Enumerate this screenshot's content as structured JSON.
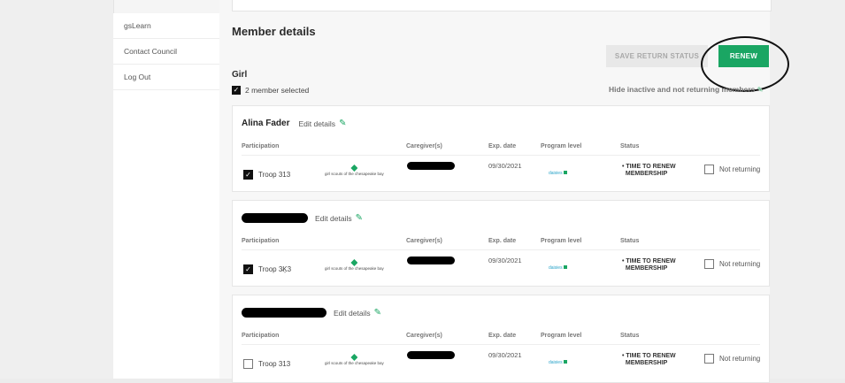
{
  "sidebar": {
    "items": [
      {
        "label": "gsLearn"
      },
      {
        "label": "Contact Council"
      },
      {
        "label": "Log Out"
      }
    ]
  },
  "main": {
    "title": "Member details",
    "buttons": {
      "save_status": "SAVE RETURN STATUS",
      "renew": "RENEW"
    },
    "group_label": "Girl",
    "selection_text": "2 member selected",
    "hide_toggle_text": "Hide inactive and not returning members",
    "columns": {
      "participation": "Participation",
      "caregivers": "Caregiver(s)",
      "exp_date": "Exp. date",
      "program_level": "Program level",
      "status": "Status"
    },
    "members": [
      {
        "name": "Alina Fader",
        "edit_label": "Edit details",
        "troop": "Troop 313",
        "troop_checked": true,
        "council": "girl scouts of the chesapeake bay",
        "exp_date": "09/30/2021",
        "program_level": "daisies",
        "status_line1": "TIME TO RENEW",
        "status_line2": "MEMBERSHIP",
        "not_returning": "Not returning"
      },
      {
        "name": "",
        "edit_label": "Edit details",
        "troop": "Troop 3̵Ķ3",
        "troop_checked": true,
        "council": "girl scouts of the chesapeake bay",
        "exp_date": "09/30/2021",
        "program_level": "daisies",
        "status_line1": "TIME TO RENEW",
        "status_line2": "MEMBERSHIP",
        "not_returning": "Not returning"
      },
      {
        "name": "",
        "edit_label": "Edit details",
        "troop": "Troop 313",
        "troop_checked": false,
        "council": "girl scouts of the chesapeake bay",
        "exp_date": "09/30/2021",
        "program_level": "daisies",
        "status_line1": "TIME TO RENEW",
        "status_line2": "MEMBERSHIP",
        "not_returning": "Not returning"
      }
    ]
  },
  "colors": {
    "accent": "#1aa663",
    "disabled": "#e8e8e8",
    "link": "#2aa3c9"
  }
}
